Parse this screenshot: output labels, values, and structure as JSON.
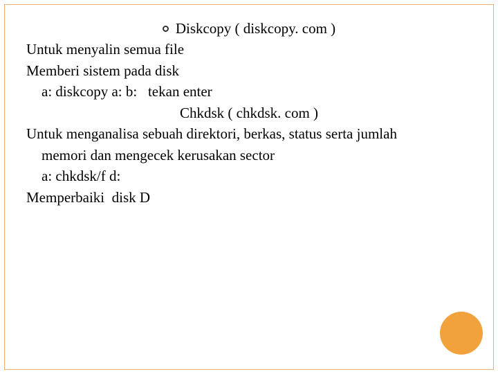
{
  "lines": {
    "l0": "Diskcopy ( diskcopy. com )",
    "l1": "Untuk menyalin semua file",
    "l2": "Memberi sistem pada disk",
    "l3": "a: diskcopy a: b:   tekan enter",
    "l4": "Chkdsk ( chkdsk. com )",
    "l5": "Untuk menganalisa sebuah direktori, berkas, status serta jumlah",
    "l6": "memori dan mengecek kerusakan sector",
    "l7": "a: chkdsk/f d:",
    "l8": "Memperbaiki  disk D"
  }
}
